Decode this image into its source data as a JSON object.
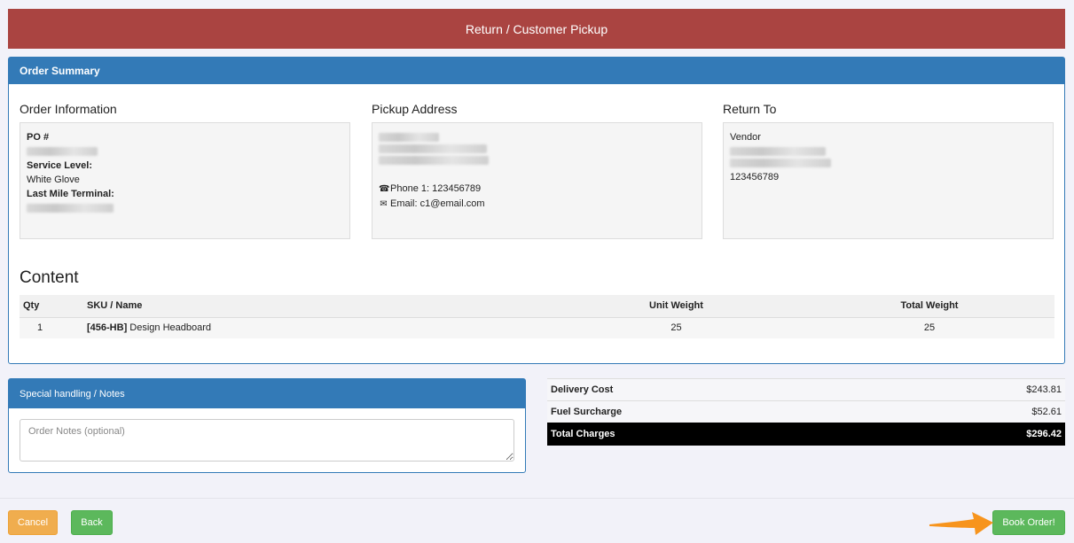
{
  "banner": {
    "title": "Return / Customer Pickup"
  },
  "order_summary": {
    "title": "Order Summary",
    "order_information": {
      "heading": "Order Information",
      "po_label": "PO #",
      "service_level_label": "Service Level:",
      "service_level_value": "White Glove",
      "last_mile_terminal_label": "Last Mile Terminal:"
    },
    "pickup_address": {
      "heading": "Pickup Address",
      "phone": "Phone 1: 123456789",
      "email": "Email: c1@email.com"
    },
    "return_to": {
      "heading": "Return To",
      "type": "Vendor",
      "phone": "123456789"
    },
    "content": {
      "title": "Content",
      "columns": {
        "qty": "Qty",
        "sku": "SKU / Name",
        "unit_weight": "Unit Weight",
        "total_weight": "Total Weight"
      },
      "rows": [
        {
          "qty": "1",
          "sku": "[456-HB]",
          "name": " Design Headboard",
          "unit_weight": "25",
          "total_weight": "25"
        }
      ]
    }
  },
  "notes": {
    "title": "Special handling / Notes",
    "placeholder": "Order Notes (optional)"
  },
  "charges": {
    "delivery_cost_label": "Delivery Cost",
    "delivery_cost_value": "$243.81",
    "fuel_surcharge_label": "Fuel Surcharge",
    "fuel_surcharge_value": "$52.61",
    "total_label": "Total Charges",
    "total_value": "$296.42"
  },
  "buttons": {
    "cancel": "Cancel",
    "back": "Back",
    "book": "Book Order!"
  },
  "colors": {
    "banner": "#aa4441",
    "panel_header": "#337ab7",
    "cancel": "#f0ad4e",
    "success": "#5cb85c",
    "arrow": "#f7941d"
  },
  "icons": {
    "phone": "phone-icon",
    "email": "envelope-icon",
    "pointer": "arrow-pointer-icon"
  }
}
